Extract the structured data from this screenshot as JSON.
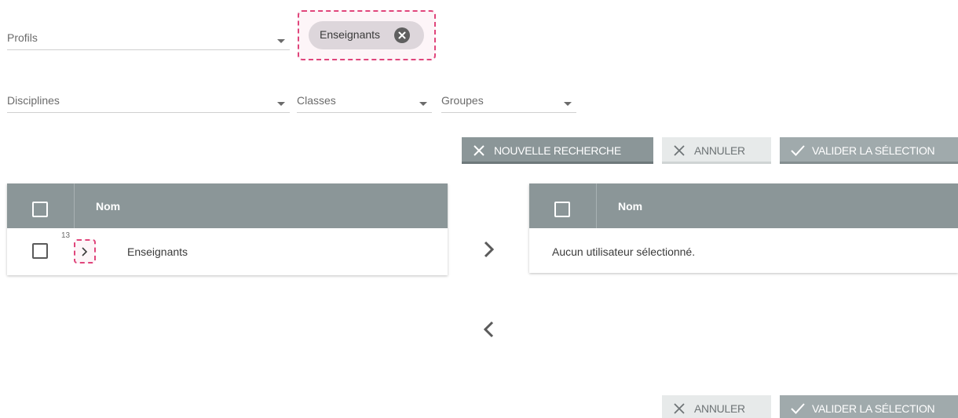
{
  "filters": {
    "profils": {
      "label": "Profils"
    },
    "disciplines": {
      "label": "Disciplines"
    },
    "classes": {
      "label": "Classes"
    },
    "groupes": {
      "label": "Groupes"
    }
  },
  "selected_chips": [
    {
      "label": "Enseignants",
      "icon": "close-circle-icon"
    }
  ],
  "actions_top": {
    "new_search": {
      "label": "Nouvelle recherche",
      "icon": "close-icon"
    },
    "cancel": {
      "label": "Annuler",
      "icon": "close-icon"
    },
    "validate": {
      "label": "Valider la sélection",
      "icon": "check-icon"
    }
  },
  "left_table": {
    "column_header": "Nom",
    "rows": [
      {
        "count": "13",
        "name": "Enseignants",
        "icon": "chevron-right-icon"
      }
    ]
  },
  "right_table": {
    "column_header": "Nom",
    "empty_message": "Aucun utilisateur sélectionné."
  },
  "transfer": {
    "add_icon": "chevron-right-icon",
    "remove_icon": "chevron-left-icon"
  },
  "actions_bottom": {
    "cancel": {
      "label": "Annuler",
      "icon": "close-icon"
    },
    "validate": {
      "label": "Valider la sélection",
      "icon": "check-icon"
    }
  },
  "colors": {
    "header_gray": "#8b9698",
    "highlight_pink": "#e0457b",
    "chip_bg": "#ddd6db"
  }
}
